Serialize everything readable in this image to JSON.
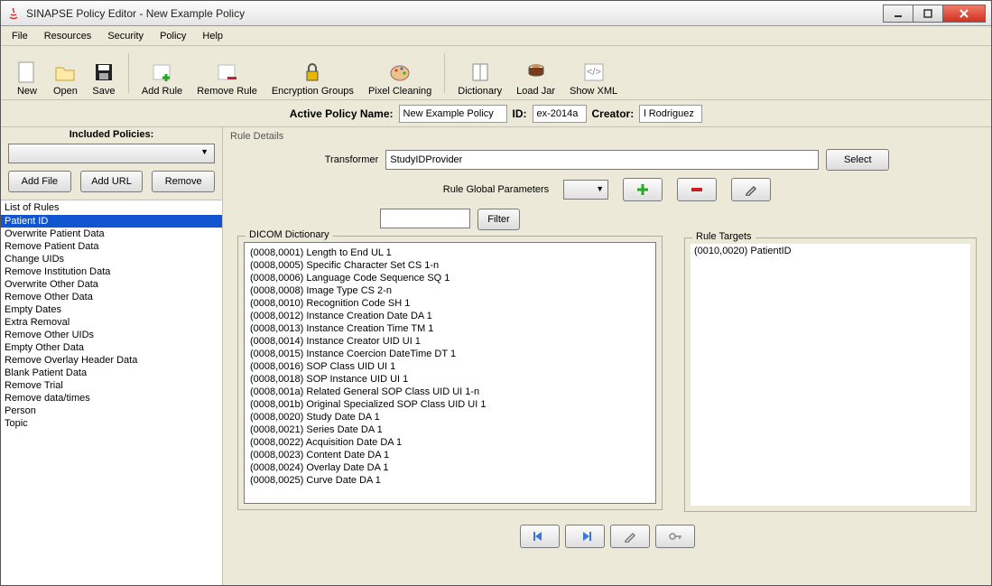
{
  "title": "SINAPSE Policy Editor - New Example Policy",
  "menu": [
    "File",
    "Resources",
    "Security",
    "Policy",
    "Help"
  ],
  "toolbar": {
    "new": "New",
    "open": "Open",
    "save": "Save",
    "addrule": "Add Rule",
    "removerule": "Remove Rule",
    "encgroups": "Encryption Groups",
    "pixelclean": "Pixel Cleaning",
    "dictionary": "Dictionary",
    "loadjar": "Load Jar",
    "showxml": "Show XML"
  },
  "active": {
    "name_label": "Active Policy Name:",
    "name_value": "New Example Policy",
    "id_label": "ID:",
    "id_value": "ex-2014a",
    "creator_label": "Creator:",
    "creator_value": "l Rodriguez"
  },
  "left": {
    "header": "Included Policies:",
    "addfile": "Add File",
    "addurl": "Add URL",
    "remove": "Remove",
    "rules_header": "List of Rules",
    "rules": [
      "Patient ID",
      "Overwrite Patient Data",
      "Remove Patient Data",
      "Change UIDs",
      "Remove Institution Data",
      "Overwrite Other Data",
      "Remove Other Data",
      "Empty Dates",
      "Extra Removal",
      "Remove Other UIDs",
      "Empty Other Data",
      "Remove Overlay Header Data",
      "Blank Patient Data",
      "Remove Trial",
      "Remove data/times",
      "Person",
      "Topic"
    ],
    "selected": 0
  },
  "details": {
    "title": "Rule Details",
    "transformer_label": "Transformer",
    "transformer_value": "StudyIDProvider",
    "select_btn": "Select",
    "globals_label": "Rule Global Parameters",
    "filter_btn": "Filter",
    "dict_legend": "DICOM Dictionary",
    "dict": [
      "(0008,0001) Length to End UL 1",
      "(0008,0005) Specific Character Set CS 1-n",
      "(0008,0006) Language Code Sequence SQ 1",
      "(0008,0008) Image Type CS 2-n",
      "(0008,0010) Recognition Code SH 1",
      "(0008,0012) Instance Creation Date DA 1",
      "(0008,0013) Instance Creation Time TM 1",
      "(0008,0014) Instance Creator UID UI 1",
      "(0008,0015) Instance Coercion DateTime DT 1",
      "(0008,0016) SOP Class UID UI 1",
      "(0008,0018) SOP Instance UID UI 1",
      "(0008,001a) Related General SOP Class UID UI 1-n",
      "(0008,001b) Original Specialized SOP Class UID UI 1",
      "(0008,0020) Study Date DA 1",
      "(0008,0021) Series Date DA 1",
      "(0008,0022) Acquisition Date DA 1",
      "(0008,0023) Content Date DA 1",
      "(0008,0024) Overlay Date DA 1",
      "(0008,0025) Curve Date DA 1"
    ],
    "targets_legend": "Rule Targets",
    "targets": [
      "(0010,0020) PatientID"
    ]
  }
}
